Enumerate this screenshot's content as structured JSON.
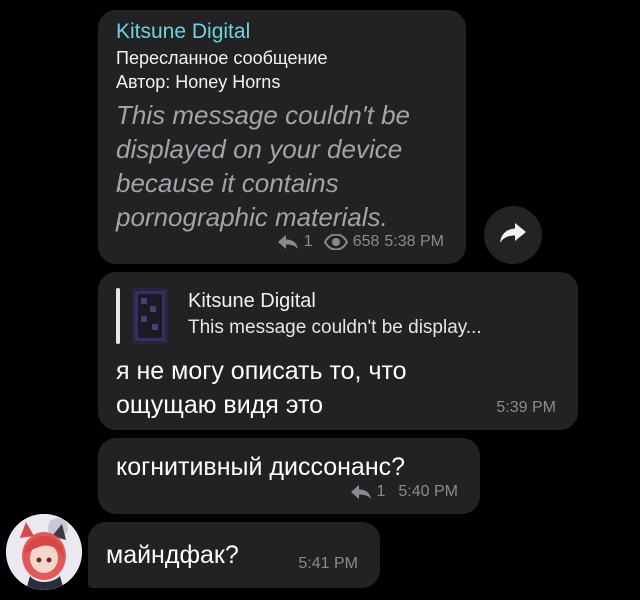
{
  "messages": [
    {
      "forward_channel": "Kitsune Digital",
      "forwarded_label": "Пересланное сообщение",
      "author_prefix": "Автор:",
      "author_name": "Honey Horns",
      "text": "This message couldn't be displayed on your device because it contains pornographic materials.",
      "replies": "1",
      "views": "658",
      "time": "5:38 PM"
    },
    {
      "reply_to_sender": "Kitsune Digital",
      "reply_to_text": "This message couldn't be display...",
      "text": "я не могу описать то, что ощущаю видя это",
      "time": "5:39 PM"
    },
    {
      "text": "когнитивный диссонанс?",
      "replies": "1",
      "time": "5:40 PM"
    },
    {
      "text": "майндфак?",
      "time": "5:41 PM"
    }
  ],
  "colors": {
    "background": "#000000",
    "bubble": "#222224",
    "sender_name": "#6fd3df",
    "meta_text": "#8a8a8f"
  },
  "icons": {
    "reply": "reply-arrow-icon",
    "views": "eye-icon",
    "share": "share-forward-icon"
  }
}
